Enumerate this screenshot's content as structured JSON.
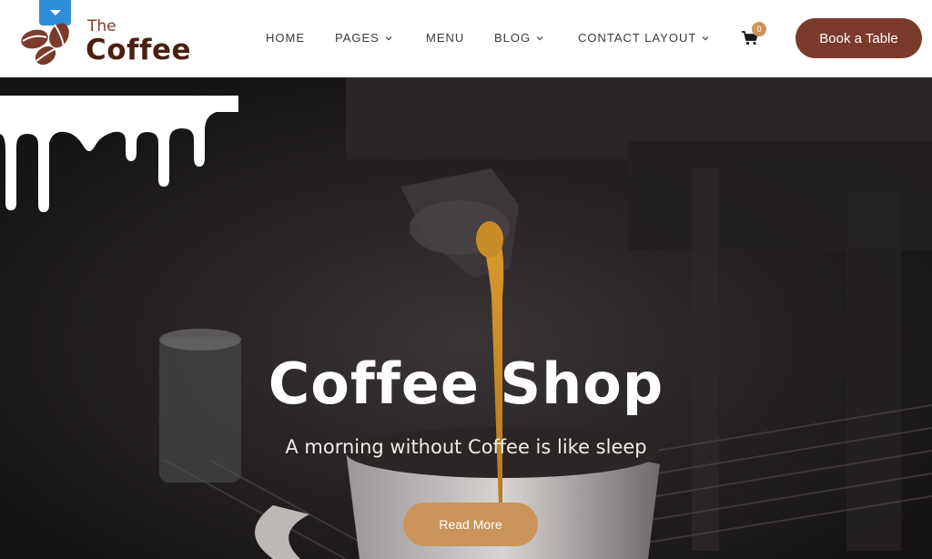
{
  "brand": {
    "name_small": "The",
    "name_large": "Coffee",
    "colors": {
      "primary": "#7a3b2b",
      "accent": "#c9955a",
      "dark": "#4a1f14"
    }
  },
  "header": {
    "ribbon_icon": "chevron-down-icon",
    "nav": [
      {
        "label": "HOME"
      },
      {
        "label": "PAGES",
        "icon": "chevron-down-icon"
      },
      {
        "label": "MENU"
      },
      {
        "label": "BLOG",
        "icon": "chevron-down-icon"
      },
      {
        "label": "CONTACT LAYOUT",
        "icon": "chevron-down-icon"
      }
    ],
    "cart": {
      "icon": "shopping-cart-icon",
      "count": "0"
    },
    "cta_label": "Book a Table"
  },
  "hero": {
    "title": "Coffee Shop",
    "subtitle": "A morning without Coffee is like sleep",
    "button_label": "Read More"
  }
}
